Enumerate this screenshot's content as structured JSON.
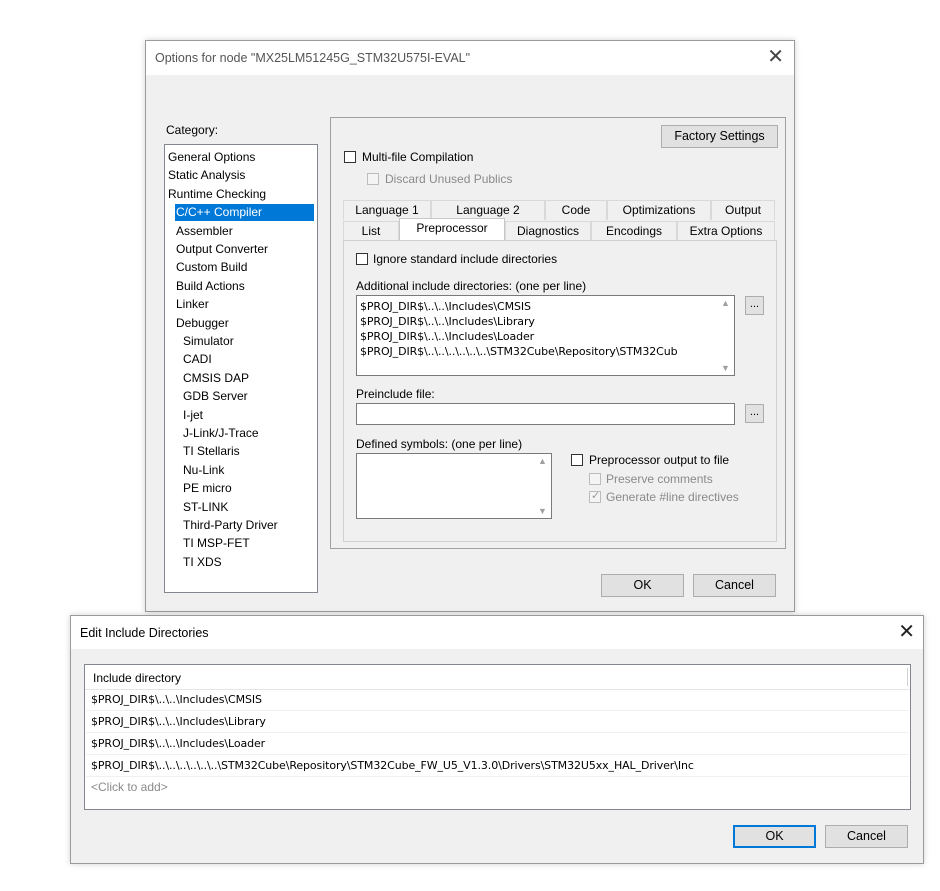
{
  "options_dialog": {
    "title": "Options for node \"MX25LM51245G_STM32U575I-EVAL\"",
    "close_glyph": "✕",
    "category_label": "Category:",
    "categories": [
      {
        "label": "General Options",
        "indent": 0,
        "selected": false
      },
      {
        "label": "Static Analysis",
        "indent": 0,
        "selected": false
      },
      {
        "label": "Runtime Checking",
        "indent": 0,
        "selected": false
      },
      {
        "label": "C/C++ Compiler",
        "indent": 1,
        "selected": true
      },
      {
        "label": "Assembler",
        "indent": 1,
        "selected": false
      },
      {
        "label": "Output Converter",
        "indent": 1,
        "selected": false
      },
      {
        "label": "Custom Build",
        "indent": 1,
        "selected": false
      },
      {
        "label": "Build Actions",
        "indent": 1,
        "selected": false
      },
      {
        "label": "Linker",
        "indent": 1,
        "selected": false
      },
      {
        "label": "Debugger",
        "indent": 1,
        "selected": false
      },
      {
        "label": "Simulator",
        "indent": 2,
        "selected": false
      },
      {
        "label": "CADI",
        "indent": 2,
        "selected": false
      },
      {
        "label": "CMSIS DAP",
        "indent": 2,
        "selected": false
      },
      {
        "label": "GDB Server",
        "indent": 2,
        "selected": false
      },
      {
        "label": "I-jet",
        "indent": 2,
        "selected": false
      },
      {
        "label": "J-Link/J-Trace",
        "indent": 2,
        "selected": false
      },
      {
        "label": "TI Stellaris",
        "indent": 2,
        "selected": false
      },
      {
        "label": "Nu-Link",
        "indent": 2,
        "selected": false
      },
      {
        "label": "PE micro",
        "indent": 2,
        "selected": false
      },
      {
        "label": "ST-LINK",
        "indent": 2,
        "selected": false
      },
      {
        "label": "Third-Party Driver",
        "indent": 2,
        "selected": false
      },
      {
        "label": "TI MSP-FET",
        "indent": 2,
        "selected": false
      },
      {
        "label": "TI XDS",
        "indent": 2,
        "selected": false
      }
    ],
    "factory_settings": "Factory Settings",
    "multifile": {
      "label": "Multi-file Compilation",
      "checked": false
    },
    "discard_unused": {
      "label": "Discard Unused Publics",
      "checked": false,
      "disabled": true
    },
    "tabs_row1": [
      "Language 1",
      "Language 2",
      "Code",
      "Optimizations",
      "Output"
    ],
    "tabs_row2": [
      "List",
      "Preprocessor",
      "Diagnostics",
      "Encodings",
      "Extra Options"
    ],
    "active_tab": "Preprocessor",
    "ignore_std": {
      "label": "Ignore standard include directories",
      "checked": false
    },
    "include_label": "Additional include directories: (one per line)",
    "include_lines": [
      "$PROJ_DIR$\\..\\..\\Includes\\CMSIS",
      "$PROJ_DIR$\\..\\..\\Includes\\Library",
      "$PROJ_DIR$\\..\\..\\Includes\\Loader",
      "$PROJ_DIR$\\..\\..\\..\\..\\..\\..\\STM32Cube\\Repository\\STM32Cub"
    ],
    "ellipsis": "...",
    "preinclude_label": "Preinclude file:",
    "preinclude_value": "",
    "defined_label": "Defined symbols: (one per line)",
    "preproc_output": {
      "label": "Preprocessor output to file",
      "checked": false
    },
    "preserve_comments": {
      "label": "Preserve comments",
      "checked": false,
      "disabled": true
    },
    "generate_line": {
      "label": "Generate #line directives",
      "checked": true,
      "disabled": true
    },
    "ok": "OK",
    "cancel": "Cancel"
  },
  "edit_dialog": {
    "title": "Edit Include Directories",
    "close_glyph": "✕",
    "column_header": "Include directory",
    "rows": [
      "$PROJ_DIR$\\..\\..\\Includes\\CMSIS",
      "$PROJ_DIR$\\..\\..\\Includes\\Library",
      "$PROJ_DIR$\\..\\..\\Includes\\Loader",
      "$PROJ_DIR$\\..\\..\\..\\..\\..\\..\\STM32Cube\\Repository\\STM32Cube_FW_U5_V1.3.0\\Drivers\\STM32U5xx_HAL_Driver\\Inc"
    ],
    "add_placeholder": "<Click to add>",
    "ok": "OK",
    "cancel": "Cancel"
  }
}
